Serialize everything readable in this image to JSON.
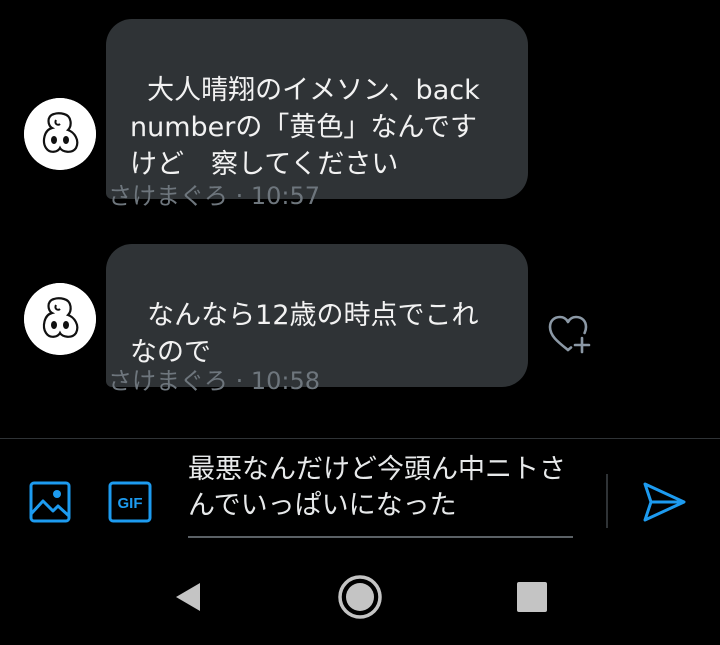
{
  "messages": [
    {
      "text": "大人晴翔のイメソン、back numberの「黄色」なんですけど　察してください",
      "sender": "さけまぐろ",
      "time": "10:57"
    },
    {
      "text": "なんなら12歳の時点でこれなので",
      "sender": "さけまぐろ",
      "time": "10:58"
    }
  ],
  "composer": {
    "draft": "最悪なんだけど今頭ん中ニトさんでいっぱいになった"
  },
  "toolbar": {
    "gif_label": "GIF"
  },
  "icons": {
    "image": "image-icon",
    "gif": "gif-icon",
    "send": "send-icon",
    "react": "heart-add-icon",
    "nav_back": "back-triangle-icon",
    "nav_home": "home-circle-icon",
    "nav_recents": "recents-square-icon"
  },
  "colors": {
    "accent": "#1d9bf0",
    "bubble": "#2f3336",
    "meta": "#6e767d"
  }
}
